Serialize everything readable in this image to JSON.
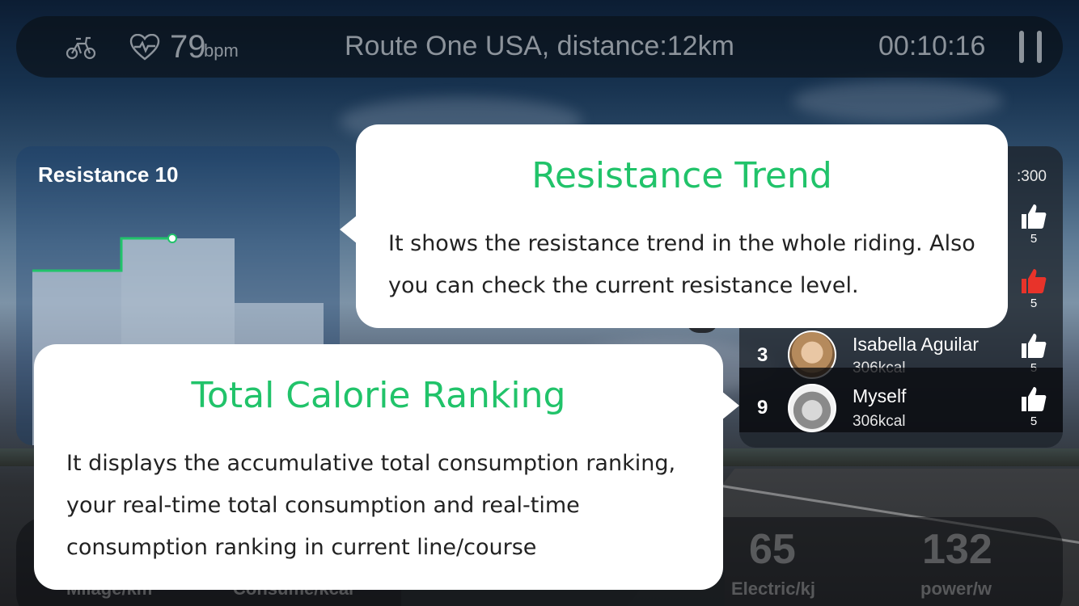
{
  "topbar": {
    "bike_icon": "bike-icon",
    "heart_icon": "heart-icon",
    "heart_rate": "79",
    "heart_rate_unit": "bpm",
    "route": "Route One USA,  distance:12km",
    "timer": "00:10:16",
    "pause_icon": "pause-icon"
  },
  "resistance": {
    "title": "Resistance 10"
  },
  "ranking": {
    "total_label": ":300",
    "rows": [
      {
        "rank": "",
        "name": "",
        "kcal": "",
        "likes": "5",
        "liked": false
      },
      {
        "rank": "",
        "name": "",
        "kcal": "",
        "likes": "5",
        "liked": true
      },
      {
        "rank": "3",
        "name": "Isabella Aguilar",
        "kcal": "306kcal",
        "likes": "5",
        "liked": false
      },
      {
        "rank": "9",
        "name": "Myself",
        "kcal": "306kcal",
        "likes": "5",
        "liked": false
      }
    ]
  },
  "stats": [
    {
      "value": "",
      "label": "Milage/km"
    },
    {
      "value": "",
      "label": "Consume/kcal"
    },
    {
      "value": "65",
      "label": "Electric/kj"
    },
    {
      "value": "132",
      "label": "power/w"
    }
  ],
  "callouts": {
    "trend": {
      "title": "Resistance Trend",
      "body": "It shows the resistance trend in the whole riding. Also you can check the current resistance level."
    },
    "ranking": {
      "title": "Total Calorie Ranking",
      "body": "It displays the accumulative total consumption ranking, your real-time total consumption and real-time consumption ranking in current line/course"
    }
  },
  "colors": {
    "accent_green": "#21c36a",
    "like_active": "#e8332a"
  }
}
